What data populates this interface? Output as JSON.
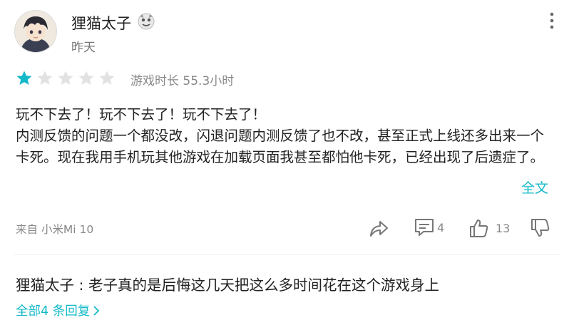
{
  "user": {
    "name": "狸猫太子",
    "date": "昨天",
    "avatar_icon": "anime-avatar-icon",
    "badge_icon": "game-badge-icon"
  },
  "rating": {
    "stars": 1,
    "max": 5,
    "playtime": "游戏时长 55.3小时",
    "accent_color": "#14b9c8",
    "empty_color": "#e2e2e2"
  },
  "review": {
    "line1": "玩不下去了！玩不下去了！玩不下去了！",
    "body": "内测反馈的问题一个都没改，闪退问题内测反馈了也不改，甚至正式上线还多出来一个卡死。现在我用手机玩其他游戏在加载页面我甚至都怕他卡死，已经出现了后遗症了。",
    "full_text_label": "全文"
  },
  "footer": {
    "source": "来自 小米Mi 10",
    "comment_count": "4",
    "like_count": "13"
  },
  "reply": {
    "text": "狸猫太子 : 老子真的是后悔这几天把这么多时间花在这个游戏身上",
    "all_replies_label": "全部4 条回复"
  }
}
